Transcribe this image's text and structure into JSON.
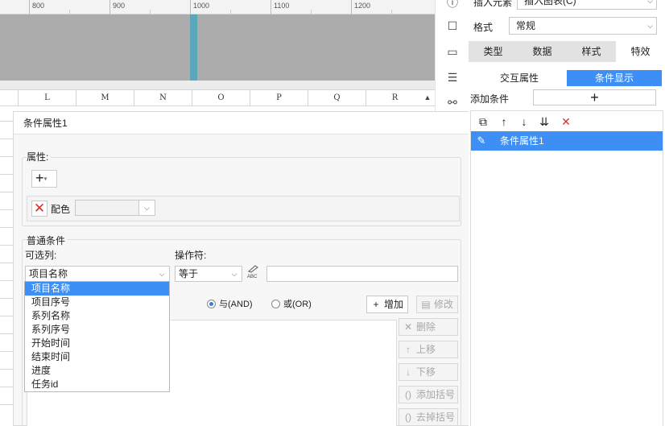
{
  "ruler": {
    "ticks": [
      "800",
      "900",
      "1000",
      "1100",
      "1200"
    ]
  },
  "sheet": {
    "columns": [
      "L",
      "M",
      "N",
      "O",
      "P",
      "Q",
      "R"
    ],
    "scroll_up_glyph": "▲"
  },
  "dialog": {
    "title": "条件属性1",
    "property_legend": "属性:",
    "add_property_glyph": "+",
    "add_property_caret": "▾",
    "delete_glyph": "✕",
    "color_label": "配色",
    "dropdown_glyph": "⌵",
    "common_legend": "普通条件",
    "optional_label": "可选列:",
    "operator_label": "操作符:",
    "column_select_value": "项目名称",
    "operator_select_value": "等于",
    "formula_icon_text": "ABC",
    "radio_and": "与(AND)",
    "radio_or": "或(OR)",
    "radio_and_checked": true,
    "buttons": {
      "add": "增加",
      "modify": "修改",
      "delete": "删除",
      "move_up": "上移",
      "move_down": "下移",
      "add_bracket": "添加括号",
      "remove_bracket": "去掉括号"
    },
    "button_icons": {
      "add": "+",
      "modify": "▤",
      "delete": "✕",
      "move_up": "↑",
      "move_down": "↓",
      "add_bracket": "()",
      "remove_bracket": "()"
    },
    "dropdown_options": [
      "项目名称",
      "项目序号",
      "系列名称",
      "系列序号",
      "开始时间",
      "结束时间",
      "进度",
      "任务id"
    ],
    "dropdown_selected_index": 0
  },
  "iconbar": {
    "icons": [
      "ⓘ",
      "☐",
      "▭",
      "☰",
      "⚯"
    ]
  },
  "right_panel": {
    "insert_element_label": "插入元素",
    "insert_element_value": "插入图表(C)",
    "format_label": "格式",
    "format_value": "常规",
    "tabs": [
      "类型",
      "数据",
      "样式",
      "特效"
    ],
    "active_tab": 3,
    "subtabs": [
      "交互属性",
      "条件显示"
    ],
    "active_subtab": 1,
    "add_condition_label": "添加条件",
    "add_condition_glyph": "+",
    "toolbar_glyphs": {
      "copy": "⧉",
      "up": "↑",
      "down": "↓",
      "bottom": "⇊",
      "delete": "✕"
    },
    "condition_item": "条件属性1",
    "edit_glyph": "✎"
  },
  "colors": {
    "accent": "#3d8ff5",
    "delete_red": "#e02b2b",
    "gantt_bg": "#acacac",
    "gantt_marker": "#5aa7b9"
  }
}
